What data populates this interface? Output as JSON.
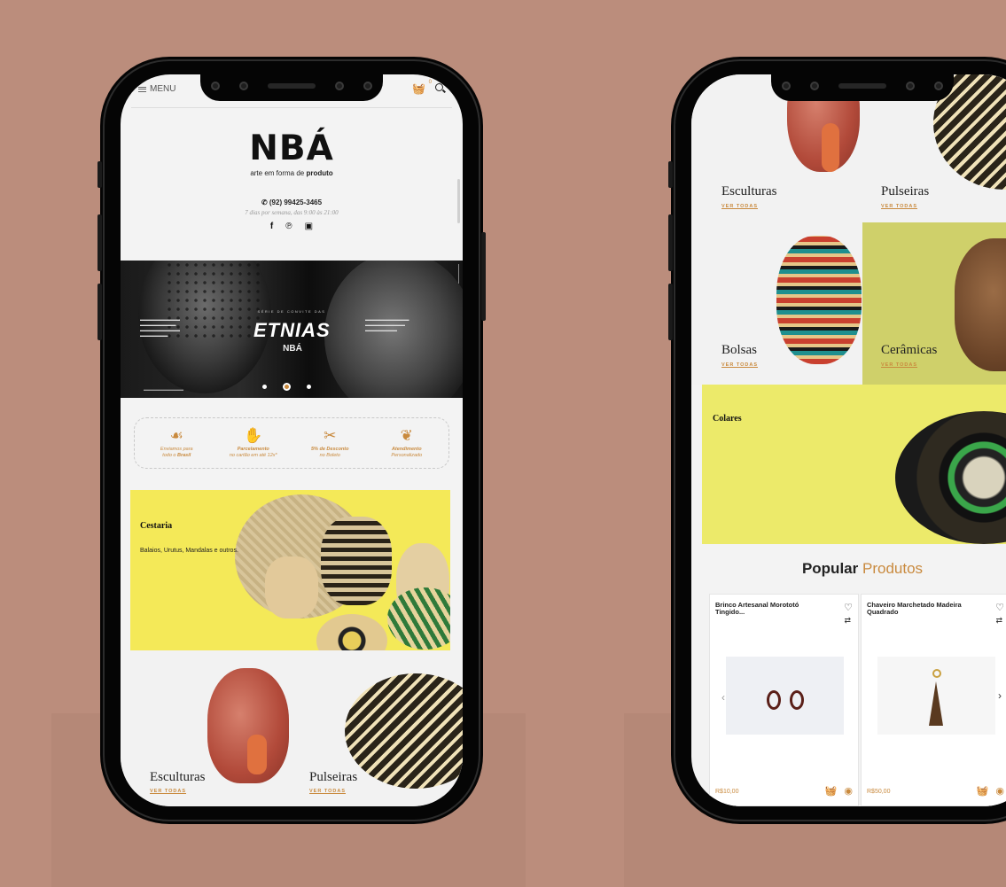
{
  "left_screen": {
    "menu_label": "MENU",
    "cart_count": "0",
    "brand": {
      "logo_text": "NBÁ",
      "tagline_prefix": "arte em forma de",
      "tagline_bold": "produto",
      "phone": "(92) 99425-3465",
      "hours": "7 dias por semana, das 9:00 às 21:00"
    },
    "hero": {
      "series_label": "SÉRIE DE CONVITE DAS",
      "title": "ETNIAS",
      "logo": "NBÁ"
    },
    "features": [
      {
        "line1": "Enviamos para",
        "line2": "todo o",
        "bold": "Brasil"
      },
      {
        "bold": "Parcelamento",
        "line2": "no cartão em até 12x*"
      },
      {
        "bold": "5% de Desconto",
        "line2": "no Boleto"
      },
      {
        "bold": "Atendimento",
        "line2": "Personalizado"
      }
    ],
    "cestaria": {
      "title": "Cestaria",
      "subtitle": "Balaios, Urutus, Mandalas e outros."
    },
    "tiles": [
      {
        "name": "Esculturas",
        "link": "VER TODAS"
      },
      {
        "name": "Pulseiras",
        "link": "VER TODAS"
      }
    ]
  },
  "right_screen": {
    "tiles": [
      {
        "name": "Esculturas",
        "link": "VER TODAS"
      },
      {
        "name": "Pulseiras",
        "link": "VER TODAS"
      },
      {
        "name": "Bolsas",
        "link": "VER TODAS"
      },
      {
        "name": "Cerâmicas",
        "link": "VER TODAS"
      }
    ],
    "colares_title": "Colares",
    "popular_bold": "Popular",
    "popular_accent": "Produtos",
    "products": [
      {
        "title": "Brinco Artesanal Morototó Tingido...",
        "price": "R$10,00"
      },
      {
        "title": "Chaveiro Marchetado Madeira Quadrado",
        "price": "R$50,00"
      }
    ]
  },
  "colors": {
    "background": "#bb8d7c",
    "accent": "#c98a3e",
    "cestaria_bg": "#f4e958",
    "colares_bg": "#ecea6a"
  }
}
